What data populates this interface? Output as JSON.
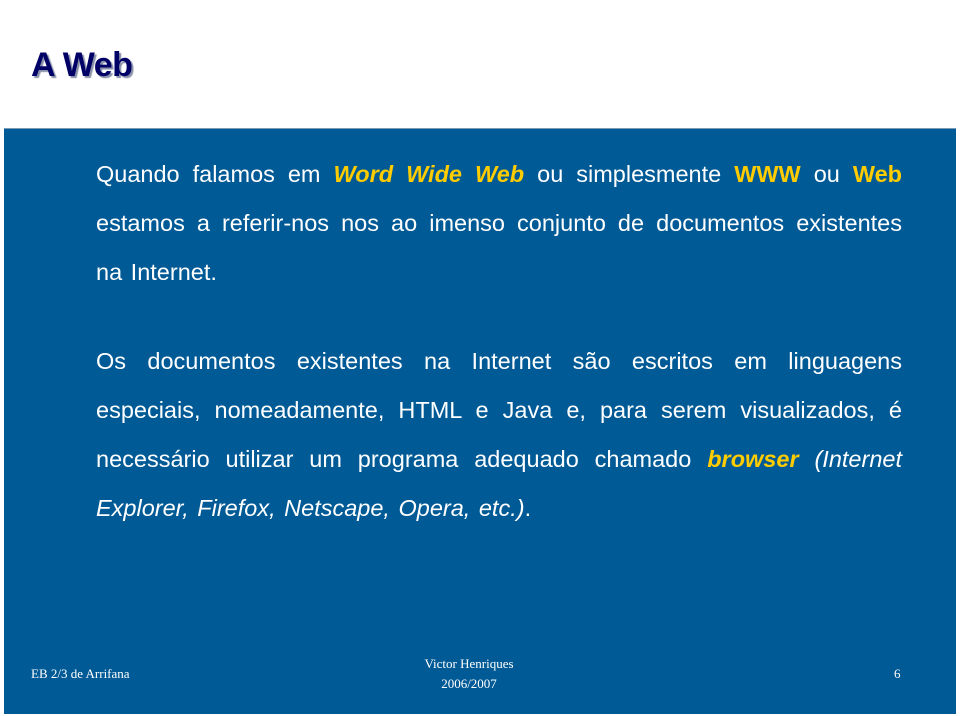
{
  "title": "A Web",
  "paragraph1": {
    "t1": "Quando falamos em ",
    "h1": "Word Wide Web",
    "t2": " ou simplesmente ",
    "h2": "WWW",
    "t3": " ou ",
    "h3": "Web",
    "t4": " estamos a referir-nos nos ao imenso conjunto de documentos existentes na Internet."
  },
  "paragraph2": {
    "t1": "Os documentos existentes na Internet são escritos em linguagens especiais, nomeadamente, HTML e Java e, para serem visualizados, é necessário utilizar um programa adequado chamado ",
    "h1": "browser",
    "t2": " (Internet Explorer, Firefox, Netscape, Opera, etc.)",
    "t3": "."
  },
  "colors": {
    "panel": "#005a96",
    "highlight": "#ffcc00",
    "title": "#000066"
  },
  "footer": {
    "school": "EB 2/3 de Arrifana",
    "author": "Victor Henriques",
    "year": "2006/2007",
    "page": "6"
  }
}
